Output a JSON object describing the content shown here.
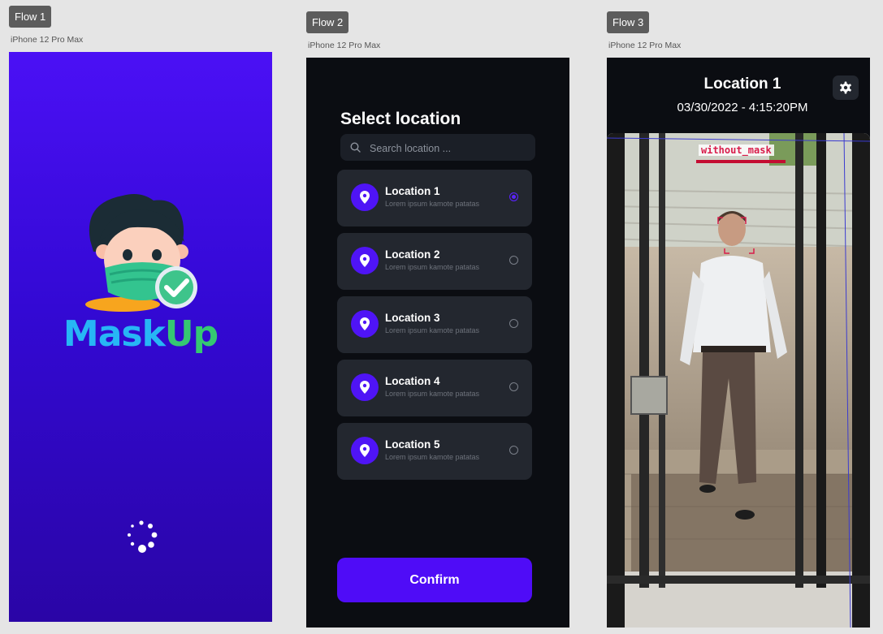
{
  "flows": [
    {
      "tag": "Flow 1",
      "device": "iPhone 12 Pro Max"
    },
    {
      "tag": "Flow 2",
      "device": "iPhone 12 Pro Max"
    },
    {
      "tag": "Flow 3",
      "device": "iPhone 12 Pro Max"
    }
  ],
  "splash": {
    "brand_part1": "Mask",
    "brand_part2": "Up",
    "icons": {
      "mascot": "masked-person-check-icon",
      "loader": "loading-spinner-icon"
    }
  },
  "select_screen": {
    "title": "Select location",
    "search": {
      "placeholder": "Search location ...",
      "value": ""
    },
    "locations": [
      {
        "name": "Location 1",
        "subtitle": "Lorem ipsum kamote patatas",
        "selected": true
      },
      {
        "name": "Location 2",
        "subtitle": "Lorem ipsum kamote patatas",
        "selected": false
      },
      {
        "name": "Location 3",
        "subtitle": "Lorem ipsum kamote patatas",
        "selected": false
      },
      {
        "name": "Location 4",
        "subtitle": "Lorem ipsum kamote patatas",
        "selected": false
      },
      {
        "name": "Location 5",
        "subtitle": "Lorem ipsum kamote patatas",
        "selected": false
      }
    ],
    "confirm_label": "Confirm"
  },
  "camera_screen": {
    "title": "Location 1",
    "datetime": "03/30/2022 - 4:15:20PM",
    "detection_label": "without_mask",
    "icons": {
      "settings": "gear-icon"
    }
  },
  "colors": {
    "accent": "#4f0cf7",
    "dark_bg": "#0b0d12",
    "card_bg": "#23272f",
    "detection": "#d81c4a",
    "brand_blue": "#27b6f5",
    "brand_green": "#35c872"
  }
}
